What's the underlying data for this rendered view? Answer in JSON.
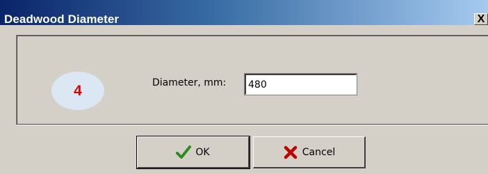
{
  "window": {
    "title": "Deadwood Diameter",
    "close_glyph": "X"
  },
  "step_badge": {
    "number": "4",
    "color": "#e00000"
  },
  "form": {
    "diameter_label": "Diameter, mm:",
    "diameter_value": "480"
  },
  "buttons": {
    "ok_label": "OK",
    "ok_icon": "checkmark-icon",
    "cancel_label": "Cancel",
    "cancel_icon": "x-cross-icon"
  },
  "colors": {
    "title_bar_start": "#0a246a",
    "title_bar_end": "#a6caf0",
    "dialog_face": "#d4d0c8",
    "ok_check": "#2e8b1e",
    "cancel_x": "#c00000"
  }
}
